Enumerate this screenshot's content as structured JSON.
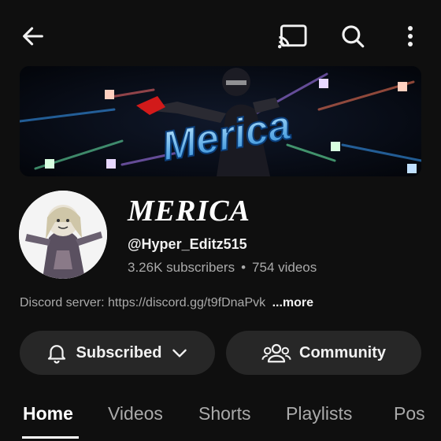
{
  "header": {
    "back_icon": "arrow-left-icon",
    "cast_icon": "cast-icon",
    "search_icon": "search-icon",
    "more_icon": "more-vertical-icon"
  },
  "banner": {
    "logo_text": "Merica"
  },
  "channel": {
    "name": "MERICA",
    "handle": "@Hyper_Editz515",
    "subscribers": "3.26K subscribers",
    "separator": "•",
    "videos": "754 videos",
    "description": "Discord server: https://discord.gg/t9fDnaPvk",
    "more_label": "...more"
  },
  "actions": {
    "subscribed_label": "Subscribed",
    "community_label": "Community"
  },
  "tabs": [
    {
      "label": "Home",
      "active": true
    },
    {
      "label": "Videos",
      "active": false
    },
    {
      "label": "Shorts",
      "active": false
    },
    {
      "label": "Playlists",
      "active": false
    },
    {
      "label": "Pos",
      "active": false
    }
  ],
  "colors": {
    "background": "#0f0f0f",
    "pill": "#272727",
    "secondary_text": "#aaaaaa"
  }
}
